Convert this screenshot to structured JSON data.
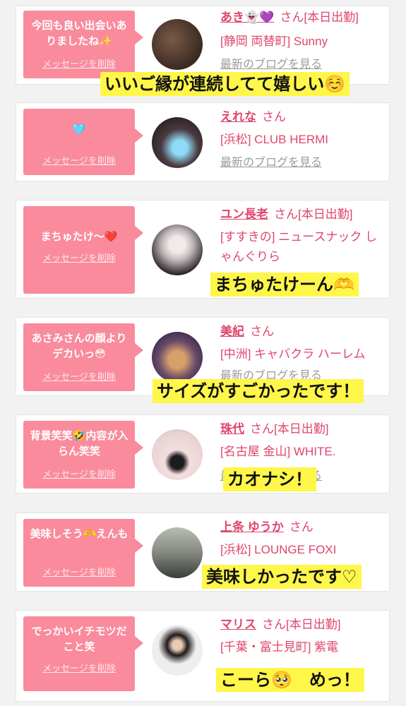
{
  "cards": [
    {
      "message": "今回も良い出会いありましたね✨",
      "delete_label": "メッセージを削除",
      "girl_name": "あき👻💜",
      "honorific": "さん",
      "status": "[本日出勤]",
      "shop": "[静岡 両替町] Sunny",
      "blog_link": "最新のブログを見る",
      "caption": "いいご縁が連続してて嬉しい☺️",
      "avatar_colors": [
        "#3a2a22",
        "#7a5a48"
      ]
    },
    {
      "message": "🩵",
      "delete_label": "メッセージを削除",
      "girl_name": "えれな",
      "honorific": "さん",
      "status": "",
      "shop": "[浜松] CLUB HERMI",
      "blog_link": "最新のブログを見る",
      "caption": "",
      "avatar_colors": [
        "#4a3a40",
        "#8fdaf5"
      ]
    },
    {
      "message": "まちゅたけ〜❤️",
      "delete_label": "メッセージを削除",
      "girl_name": "ユン長老",
      "honorific": "さん",
      "status": "[本日出勤]",
      "shop": "[すすきの] ニュースナック しゃんぐりら",
      "blog_link": "",
      "caption": "まちゅたけーん🫶",
      "avatar_colors": [
        "#d9d4d4",
        "#2a2226"
      ]
    },
    {
      "message": "あさみさんの顔よりデカいっ😳",
      "delete_label": "メッセージを削除",
      "girl_name": "美紀",
      "honorific": "さん",
      "status": "",
      "shop": "[中洲] キャバクラ ハーレム",
      "blog_link": "最新のブログを見る",
      "caption": "サイズがすごかったです！",
      "avatar_colors": [
        "#3b2a4a",
        "#d7a06a"
      ]
    },
    {
      "message": "背景笑笑🤣内容が入らん笑笑",
      "delete_label": "メッセージを削除",
      "girl_name": "珠代",
      "honorific": "さん",
      "status": "[本日出勤]",
      "shop": "[名古屋 金山] WHITE.",
      "blog_link": "最新のブログを見る",
      "caption": "カオナシ！",
      "avatar_colors": [
        "#f3dede",
        "#2b2b2b"
      ]
    },
    {
      "message": "美味しそう🫶えんも",
      "delete_label": "メッセージを削除",
      "girl_name": "上条 ゆうか",
      "honorific": "さん",
      "status": "",
      "shop": "[浜松] LOUNGE FOXI",
      "blog_link": "",
      "caption": "美味しかったです♡",
      "avatar_colors": [
        "#8a8f86",
        "#3b3d38"
      ]
    },
    {
      "message": "でっかいイチモツだこと笑",
      "delete_label": "メッセージを削除",
      "girl_name": "マリス",
      "honorific": "さん",
      "status": "[本日出勤]",
      "shop": "[千葉・富士見町] 紫電",
      "blog_link": "",
      "caption": "こーら🥺　めっ！",
      "avatar_colors": [
        "#eeeeee",
        "#1f1b1b"
      ]
    }
  ]
}
